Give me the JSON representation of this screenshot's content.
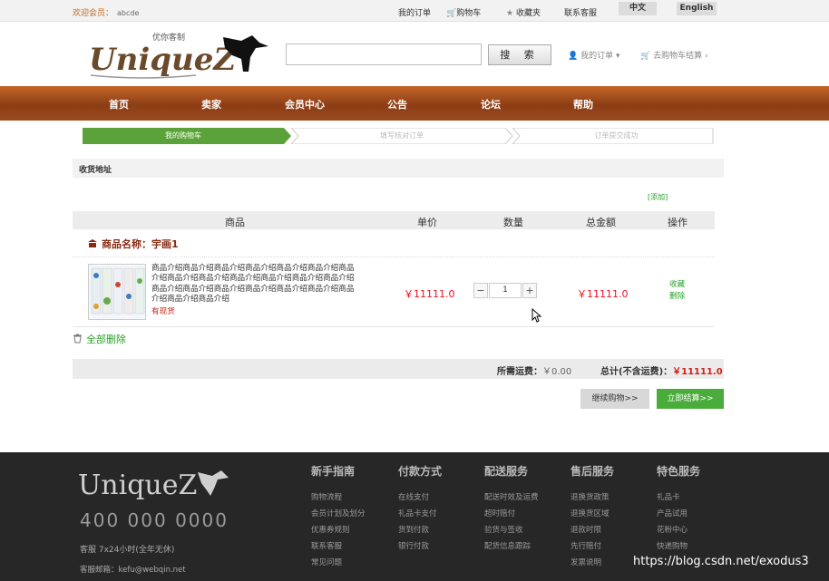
{
  "topbar": {
    "welcome": "欢迎会员：",
    "username": "abcde",
    "links": [
      "我的订单",
      "购物车",
      "收藏夹",
      "联系客服"
    ],
    "lang_cn": "中文",
    "lang_en": "English"
  },
  "header": {
    "logo_tag": "优你客制",
    "logo_text": "UniqueZ",
    "search_placeholder": "",
    "search_button": "搜 索",
    "my_orders": "我的订单",
    "checkout": "去购物车结算"
  },
  "nav": [
    "首页",
    "卖家",
    "会员中心",
    "公告",
    "论坛",
    "帮助"
  ],
  "steps": [
    "我的购物车",
    "填写核对订单",
    "订单提交成功"
  ],
  "address": {
    "title": "收货地址",
    "add_link": "[添加]"
  },
  "table": {
    "headers": [
      "商品",
      "单价",
      "数量",
      "总金额",
      "操作"
    ],
    "shop_label": "商品名称：宇画1",
    "item": {
      "description": "商品介绍商品介绍商品介绍商品介绍商品介绍商品介绍商品介绍商品介绍商品介绍商品介绍商品介绍商品介绍商品介绍商品介绍商品介绍商品介绍商品介绍商品介绍商品介绍商品介绍商品介绍商品介绍",
      "stock": "有现货",
      "unit_price": "￥11111.0",
      "quantity": "1",
      "total": "￥11111.0",
      "ops": [
        "收藏",
        "删除"
      ]
    }
  },
  "actions": {
    "delete_all": "全部删除",
    "shipping_label": "所需运费：",
    "shipping_value": "￥0.00",
    "total_label": "总计(不含运费)：",
    "total_value": "￥11111.0",
    "continue": "继续购物>>",
    "pay": "立即结算>>"
  },
  "footer": {
    "logo_text": "UniqueZ",
    "phone": "400 000 0000",
    "service": "客服 7x24小时(全年无休)",
    "email": "客服邮箱：kefu@webqin.net",
    "columns": [
      {
        "title": "新手指南",
        "items": [
          "购物流程",
          "会员计划及划分",
          "优惠券规则",
          "联系客服",
          "常见问题"
        ]
      },
      {
        "title": "付款方式",
        "items": [
          "在线支付",
          "礼品卡支付",
          "货到付款",
          "银行付款"
        ]
      },
      {
        "title": "配送服务",
        "items": [
          "配送时效及运费",
          "超时赔付",
          "验货与签收",
          "配货信息跟踪"
        ]
      },
      {
        "title": "售后服务",
        "items": [
          "退换货政策",
          "退换货区域",
          "退款时限",
          "先行赔付",
          "发票说明"
        ]
      },
      {
        "title": "特色服务",
        "items": [
          "礼品卡",
          "产品试用",
          "花粉中心",
          "快递购物",
          ""
        ]
      }
    ]
  },
  "watermark": "https://blog.csdn.net/exodus3",
  "colors": {
    "nav": "#8c3d14",
    "price": "#e11122",
    "green": "#4aac3a",
    "footer": "#272727"
  }
}
